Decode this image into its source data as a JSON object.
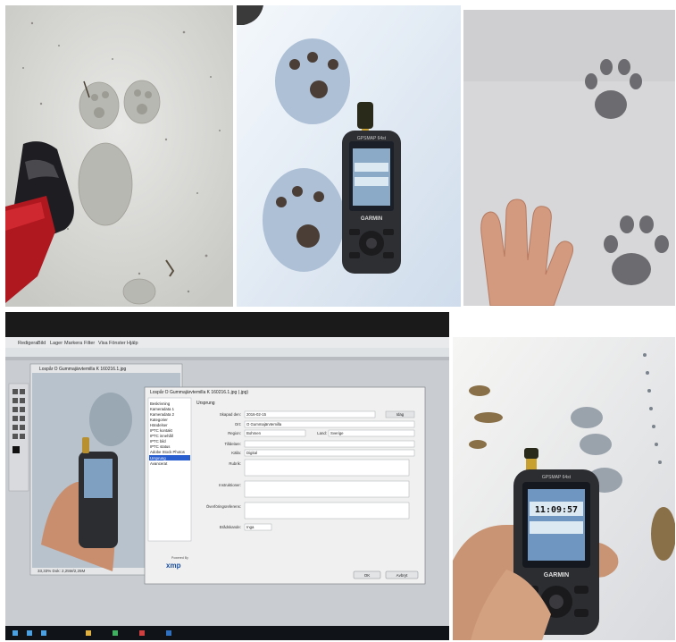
{
  "panels": {
    "p1": {
      "label": "snow-tracks-with-boot"
    },
    "p2": {
      "label": "tracks-with-gps"
    },
    "p3": {
      "label": "tracks-with-hand"
    },
    "p4": {
      "label": "monitor-screenshot"
    },
    "p5": {
      "label": "hand-holding-gps"
    }
  },
  "gps": {
    "brand": "GARMIN",
    "model": "GPSMAP 64st",
    "screen_reading": "11:09:57"
  },
  "monitor": {
    "menubar": [
      "Redigera",
      "Bild",
      "Lager",
      "Markera",
      "Filter",
      "Visa",
      "Fönster",
      "Hjälp"
    ],
    "image_window_title": "Lospår O Gummajärvtemilla K 160216.1.jpg",
    "image_window_status": "33,33% Dok: 2,25M/2,25M",
    "dialog_title": "Lospår O Gummajärvtemilla K 160216.1.jpg (.jpg)",
    "dialog_section": "Ursprung",
    "sidebar_items": [
      "Beskrivning",
      "Kameradata 1",
      "Kameradata 2",
      "Kategorier",
      "Händelser",
      "IPTC kontakt",
      "IPTC innehåll",
      "IPTC bild",
      "IPTC status",
      "Adobe Stock Photos",
      "Ursprung",
      "Avancerat"
    ],
    "selected_item": "Ursprung",
    "fields": {
      "date_label": "Skapad den:",
      "date_value": "2016-02-15",
      "idag_button": "Idag",
      "city_label": "Ort:",
      "city_value": "O Gummajärvtemilla",
      "region_label": "Region:",
      "region_value": "Bohmen",
      "country_label": "Land:",
      "country_value": "Sverige",
      "title_label": "Tilldelare:",
      "source_label": "Källa:",
      "source_value": "Digital",
      "headline_label": "Rubrik:",
      "instructions_label": "Instruktioner:",
      "transfer_label": "Överföringsreferens:",
      "priority_label": "Brådskande:",
      "priority_value": "Inga"
    },
    "xmp_caption": "Powered By",
    "xmp_logo": "xmp",
    "ok_button": "OK",
    "cancel_button": "Avbryt"
  }
}
